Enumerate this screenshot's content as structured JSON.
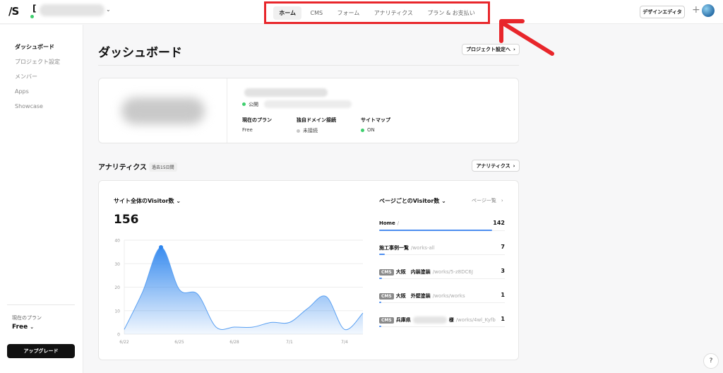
{
  "header": {
    "logo": "/S",
    "project_initial": "[",
    "nav_tabs": [
      {
        "label": "ホーム",
        "active": true
      },
      {
        "label": "CMS",
        "active": false
      },
      {
        "label": "フォーム",
        "active": false
      },
      {
        "label": "アナリティクス",
        "active": false
      },
      {
        "label": "プラン & お支払い",
        "active": false
      }
    ],
    "design_editor_label": "デザインエディタ",
    "plus": "+"
  },
  "sidebar": {
    "items": [
      {
        "label": "ダッシュボード",
        "active": true
      },
      {
        "label": "プロジェクト設定",
        "active": false
      },
      {
        "label": "メンバー",
        "active": false
      },
      {
        "label": "Apps",
        "active": false
      },
      {
        "label": "Showcase",
        "active": false
      }
    ],
    "plan_label": "現在のプラン",
    "plan_value": "Free",
    "upgrade_label": "アップグレード"
  },
  "main": {
    "title": "ダッシュボード",
    "project_settings_btn": "プロジェクト設定へ",
    "status": "公開",
    "info": [
      {
        "label": "現在のプラン",
        "value": "Free",
        "dot": ""
      },
      {
        "label": "独自ドメイン接続",
        "value": "未接続",
        "dot": "#c8c8c8"
      },
      {
        "label": "サイトマップ",
        "value": "ON",
        "dot": "#3ecf6e"
      }
    ],
    "analytics_title": "アナリティクス",
    "analytics_badge": "過去15日間",
    "analytics_btn": "アナリティクス",
    "site_visitors_title": "サイト全体のVisitor数",
    "site_visitors_total": "156",
    "pages_title": "ページごとのVisitor数",
    "pages_link": "ページ一覧",
    "pages": [
      {
        "tag": "",
        "name": "Home",
        "path": "/",
        "count": "142",
        "ratio": 1.0
      },
      {
        "tag": "",
        "name": "施工事例一覧",
        "path": "/works-all",
        "count": "7",
        "ratio": 0.05
      },
      {
        "tag": "CMS",
        "name": "大阪　内装塗装",
        "path": "/works/5-z8DC6J",
        "count": "3",
        "ratio": 0.025
      },
      {
        "tag": "CMS",
        "name": "大阪　外壁塗装",
        "path": "/works/works",
        "count": "1",
        "ratio": 0.01
      },
      {
        "tag": "CMS",
        "name": "兵庫県",
        "suffix": "様",
        "path": "/works/4wl_Kyfb",
        "count": "1",
        "ratio": 0.01
      }
    ]
  },
  "chart_data": {
    "type": "area",
    "title": "サイト全体のVisitor数",
    "x": [
      "6/22",
      "6/23",
      "6/24",
      "6/25",
      "6/26",
      "6/27",
      "6/28",
      "6/29",
      "6/30",
      "7/1",
      "7/2",
      "7/3",
      "7/4",
      "7/5",
      "7/6"
    ],
    "x_tick_labels": [
      "6/22",
      "6/25",
      "6/28",
      "7/1",
      "7/4"
    ],
    "values": [
      2,
      18,
      37,
      19,
      17,
      3,
      3,
      3,
      5,
      5,
      11,
      16,
      2,
      9
    ],
    "ylim": [
      0,
      40
    ],
    "y_ticks": [
      0,
      10,
      20,
      30,
      40
    ],
    "highlight_index": 2,
    "color": "#2f86ee",
    "grid": true
  },
  "help": "?"
}
